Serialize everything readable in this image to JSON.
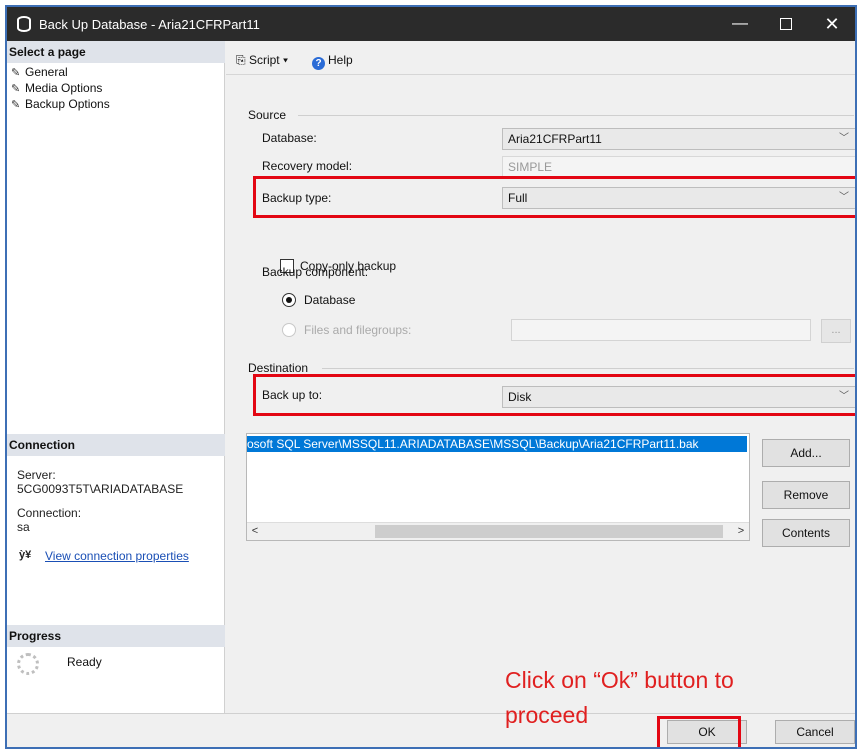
{
  "window": {
    "title": "Back Up Database - Aria21CFRPart11",
    "minimize": "—",
    "close": "✕"
  },
  "sidebar": {
    "select_page_header": "Select a page",
    "pages": [
      "General",
      "Media Options",
      "Backup Options"
    ],
    "connection_header": "Connection",
    "server_label": "Server:",
    "server_value": "5CG0093T5T\\ARIADATABASE",
    "connection_label": "Connection:",
    "connection_value": "sa",
    "view_connection_link": "View connection properties",
    "progress_header": "Progress",
    "progress_status": "Ready"
  },
  "toolbar": {
    "script_label": "Script",
    "help_label": "Help"
  },
  "source": {
    "group_title": "Source",
    "database_label": "Database:",
    "database_value": "Aria21CFRPart11",
    "recovery_model_label": "Recovery model:",
    "recovery_model_value": "SIMPLE",
    "backup_type_label": "Backup type:",
    "backup_type_value": "Full",
    "copy_only_label": "Copy-only backup",
    "copy_only_checked": false,
    "backup_component_label": "Backup component:",
    "component_database": "Database",
    "component_files": "Files and filegroups:",
    "selected_component": "Database",
    "ellipsis_label": "..."
  },
  "destination": {
    "group_title": "Destination",
    "back_up_to_label": "Back up to:",
    "back_up_to_value": "Disk",
    "paths": [
      "osoft SQL Server\\MSSQL11.ARIADATABASE\\MSSQL\\Backup\\Aria21CFRPart11.bak"
    ],
    "add_label": "Add...",
    "remove_label": "Remove",
    "contents_label": "Contents"
  },
  "footer": {
    "ok_label": "OK",
    "cancel_label": "Cancel"
  },
  "annotation": {
    "text": "Click on “Ok” button to\nproceed",
    "color": "#e02020",
    "highlight_color": "#e30613"
  }
}
